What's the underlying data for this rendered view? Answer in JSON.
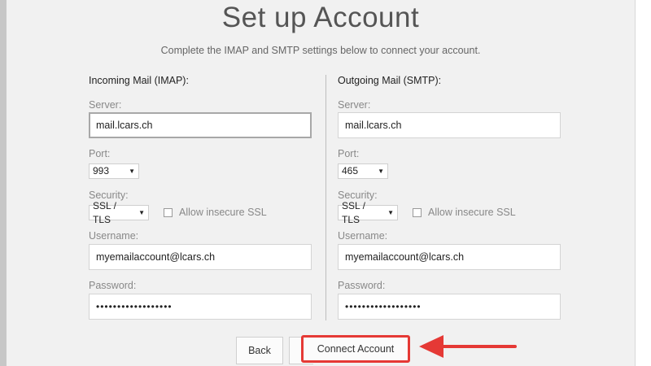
{
  "page": {
    "title": "Set up Account",
    "subtitle": "Complete the IMAP and SMTP settings below to connect your account."
  },
  "incoming": {
    "heading": "Incoming Mail (IMAP):",
    "server_label": "Server:",
    "server_value": "mail.lcars.ch",
    "port_label": "Port:",
    "port_value": "993",
    "security_label": "Security:",
    "security_value": "SSL / TLS",
    "insecure_label": "Allow insecure SSL",
    "username_label": "Username:",
    "username_value": "myemailaccount@lcars.ch",
    "password_label": "Password:",
    "password_value": "••••••••••••••••••"
  },
  "outgoing": {
    "heading": "Outgoing Mail (SMTP):",
    "server_label": "Server:",
    "server_value": "mail.lcars.ch",
    "port_label": "Port:",
    "port_value": "465",
    "security_label": "Security:",
    "security_value": "SSL / TLS",
    "insecure_label": "Allow insecure SSL",
    "username_label": "Username:",
    "username_value": "myemailaccount@lcars.ch",
    "password_label": "Password:",
    "password_value": "••••••••••••••••••"
  },
  "buttons": {
    "back_label": "Back",
    "connect_label": "Connect Account"
  },
  "icons": {
    "dropdown": "chevron-down-icon",
    "annotation": "red-arrow-left-icon"
  },
  "colors": {
    "highlight": "#e53935"
  }
}
